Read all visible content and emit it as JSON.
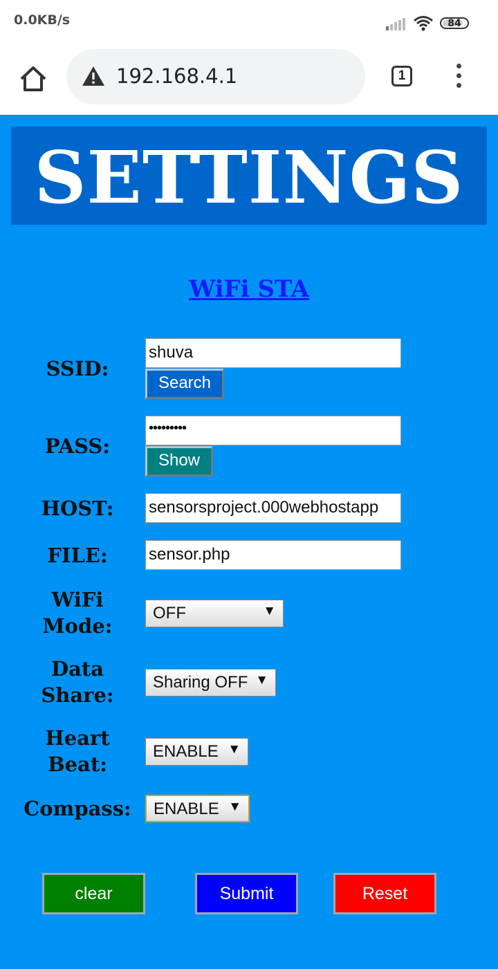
{
  "status_bar": {
    "net_speed": "0.0KB/s",
    "battery_level": "84"
  },
  "browser": {
    "url": "192.168.4.1",
    "tab_count": "1"
  },
  "banner": {
    "title": "SETTINGS"
  },
  "section": {
    "link_text": "WiFi STA"
  },
  "form": {
    "ssid": {
      "label": "SSID:",
      "value": "shuva",
      "button_label": "Search"
    },
    "pass": {
      "label": "PASS:",
      "value": "•••••••••",
      "button_label": "Show"
    },
    "host": {
      "label": "HOST:",
      "value": "sensorsproject.000webhostapp"
    },
    "file": {
      "label": "FILE:",
      "value": "sensor.php"
    },
    "wifi_mode": {
      "label_line1": "WiFi",
      "label_line2": "Mode:",
      "selected": "OFF"
    },
    "data_share": {
      "label_line1": "Data",
      "label_line2": "Share:",
      "selected": "Sharing OFF"
    },
    "heart_beat": {
      "label_line1": "Heart",
      "label_line2": "Beat:",
      "selected": "ENABLE"
    },
    "compass": {
      "label": "Compass:",
      "selected": "ENABLE"
    }
  },
  "actions": {
    "clear_label": "clear",
    "submit_label": "Submit",
    "reset_label": "Reset"
  },
  "colors": {
    "page_background": "#0093f5",
    "banner_background": "#0066cc",
    "search_button": "#0066cc",
    "show_button": "#008080",
    "clear_button": "#008000",
    "submit_button": "#0000ff",
    "reset_button": "#ff0000"
  },
  "icons": [
    "signal-icon",
    "wifi-icon",
    "battery-icon",
    "home-icon",
    "warning-icon",
    "tabs-icon",
    "menu-icon",
    "dropdown-arrow-icon"
  ]
}
